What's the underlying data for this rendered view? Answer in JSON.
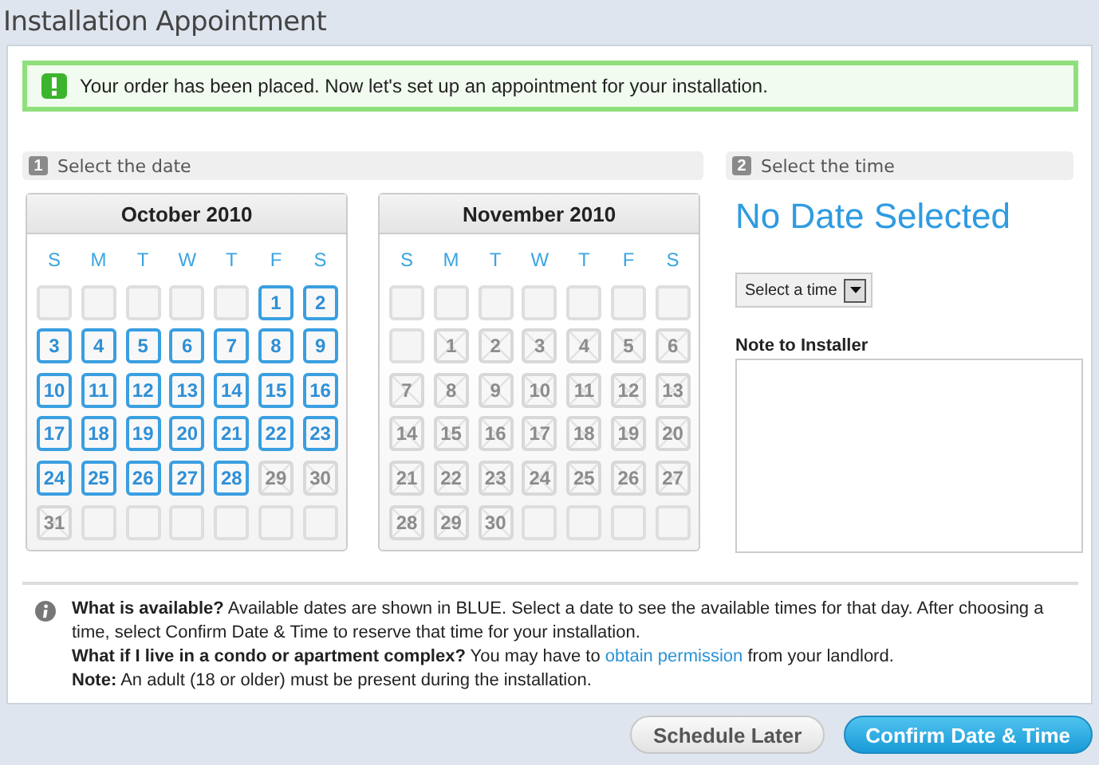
{
  "title": "Installation Appointment",
  "banner": {
    "text": "Your order has been placed. Now let's set up an appointment for your installation."
  },
  "date_section": {
    "step": "1",
    "label": "Select the date"
  },
  "time_section": {
    "step": "2",
    "label": "Select the time"
  },
  "calendars": [
    {
      "month": "October 2010",
      "weekdays": [
        "S",
        "M",
        "T",
        "W",
        "T",
        "F",
        "S"
      ],
      "weeks": [
        [
          {
            "kind": "blank"
          },
          {
            "kind": "blank"
          },
          {
            "kind": "blank"
          },
          {
            "kind": "blank"
          },
          {
            "kind": "blank"
          },
          {
            "kind": "available",
            "day": "1"
          },
          {
            "kind": "available",
            "day": "2"
          }
        ],
        [
          {
            "kind": "available",
            "day": "3"
          },
          {
            "kind": "available",
            "day": "4"
          },
          {
            "kind": "available",
            "day": "5"
          },
          {
            "kind": "available",
            "day": "6"
          },
          {
            "kind": "available",
            "day": "7"
          },
          {
            "kind": "available",
            "day": "8"
          },
          {
            "kind": "available",
            "day": "9"
          }
        ],
        [
          {
            "kind": "available",
            "day": "10"
          },
          {
            "kind": "available",
            "day": "11"
          },
          {
            "kind": "available",
            "day": "12"
          },
          {
            "kind": "available",
            "day": "13"
          },
          {
            "kind": "available",
            "day": "14"
          },
          {
            "kind": "available",
            "day": "15"
          },
          {
            "kind": "available",
            "day": "16"
          }
        ],
        [
          {
            "kind": "available",
            "day": "17"
          },
          {
            "kind": "available",
            "day": "18"
          },
          {
            "kind": "available",
            "day": "19"
          },
          {
            "kind": "available",
            "day": "20"
          },
          {
            "kind": "available",
            "day": "21"
          },
          {
            "kind": "available",
            "day": "22"
          },
          {
            "kind": "available",
            "day": "23"
          }
        ],
        [
          {
            "kind": "available",
            "day": "24"
          },
          {
            "kind": "available",
            "day": "25"
          },
          {
            "kind": "available",
            "day": "26"
          },
          {
            "kind": "available",
            "day": "27"
          },
          {
            "kind": "available",
            "day": "28"
          },
          {
            "kind": "unavailable",
            "day": "29"
          },
          {
            "kind": "unavailable",
            "day": "30"
          }
        ],
        [
          {
            "kind": "unavailable",
            "day": "31"
          },
          {
            "kind": "blank"
          },
          {
            "kind": "blank"
          },
          {
            "kind": "blank"
          },
          {
            "kind": "blank"
          },
          {
            "kind": "blank"
          },
          {
            "kind": "blank"
          }
        ]
      ]
    },
    {
      "month": "November 2010",
      "weekdays": [
        "S",
        "M",
        "T",
        "W",
        "T",
        "F",
        "S"
      ],
      "weeks": [
        [
          {
            "kind": "blank"
          },
          {
            "kind": "blank"
          },
          {
            "kind": "blank"
          },
          {
            "kind": "blank"
          },
          {
            "kind": "blank"
          },
          {
            "kind": "blank"
          },
          {
            "kind": "blank"
          }
        ],
        [
          {
            "kind": "blank"
          },
          {
            "kind": "unavailable",
            "day": "1"
          },
          {
            "kind": "unavailable",
            "day": "2"
          },
          {
            "kind": "unavailable",
            "day": "3"
          },
          {
            "kind": "unavailable",
            "day": "4"
          },
          {
            "kind": "unavailable",
            "day": "5"
          },
          {
            "kind": "unavailable",
            "day": "6"
          }
        ],
        [
          {
            "kind": "unavailable",
            "day": "7"
          },
          {
            "kind": "unavailable",
            "day": "8"
          },
          {
            "kind": "unavailable",
            "day": "9"
          },
          {
            "kind": "unavailable",
            "day": "10"
          },
          {
            "kind": "unavailable",
            "day": "11"
          },
          {
            "kind": "unavailable",
            "day": "12"
          },
          {
            "kind": "unavailable",
            "day": "13"
          }
        ],
        [
          {
            "kind": "unavailable",
            "day": "14"
          },
          {
            "kind": "unavailable",
            "day": "15"
          },
          {
            "kind": "unavailable",
            "day": "16"
          },
          {
            "kind": "unavailable",
            "day": "17"
          },
          {
            "kind": "unavailable",
            "day": "18"
          },
          {
            "kind": "unavailable",
            "day": "19"
          },
          {
            "kind": "unavailable",
            "day": "20"
          }
        ],
        [
          {
            "kind": "unavailable",
            "day": "21"
          },
          {
            "kind": "unavailable",
            "day": "22"
          },
          {
            "kind": "unavailable",
            "day": "23"
          },
          {
            "kind": "unavailable",
            "day": "24"
          },
          {
            "kind": "unavailable",
            "day": "25"
          },
          {
            "kind": "unavailable",
            "day": "26"
          },
          {
            "kind": "unavailable",
            "day": "27"
          }
        ],
        [
          {
            "kind": "unavailable",
            "day": "28"
          },
          {
            "kind": "unavailable",
            "day": "29"
          },
          {
            "kind": "unavailable",
            "day": "30"
          },
          {
            "kind": "blank"
          },
          {
            "kind": "blank"
          },
          {
            "kind": "blank"
          },
          {
            "kind": "blank"
          }
        ]
      ]
    }
  ],
  "selected_date": "No Date Selected",
  "time_select": {
    "value": "Select a time"
  },
  "note": {
    "label": "Note to Installer"
  },
  "info": [
    {
      "label": "What is available?",
      "text": "Available dates are shown in BLUE. Select a date to see the available times for that day. After choosing a time, select Confirm Date & Time to reserve that time for your installation."
    },
    {
      "label": "What if I live in a condo or apartment complex?",
      "text": "You may have to",
      "link": "obtain permission",
      "after": "from your landlord."
    },
    {
      "label": "Note:",
      "text": "An adult (18 or older) must be present during the installation."
    }
  ],
  "buttons": [
    {
      "label": "Schedule Later",
      "kind": "secondary"
    },
    {
      "label": "Confirm Date & Time",
      "kind": "primary"
    }
  ]
}
